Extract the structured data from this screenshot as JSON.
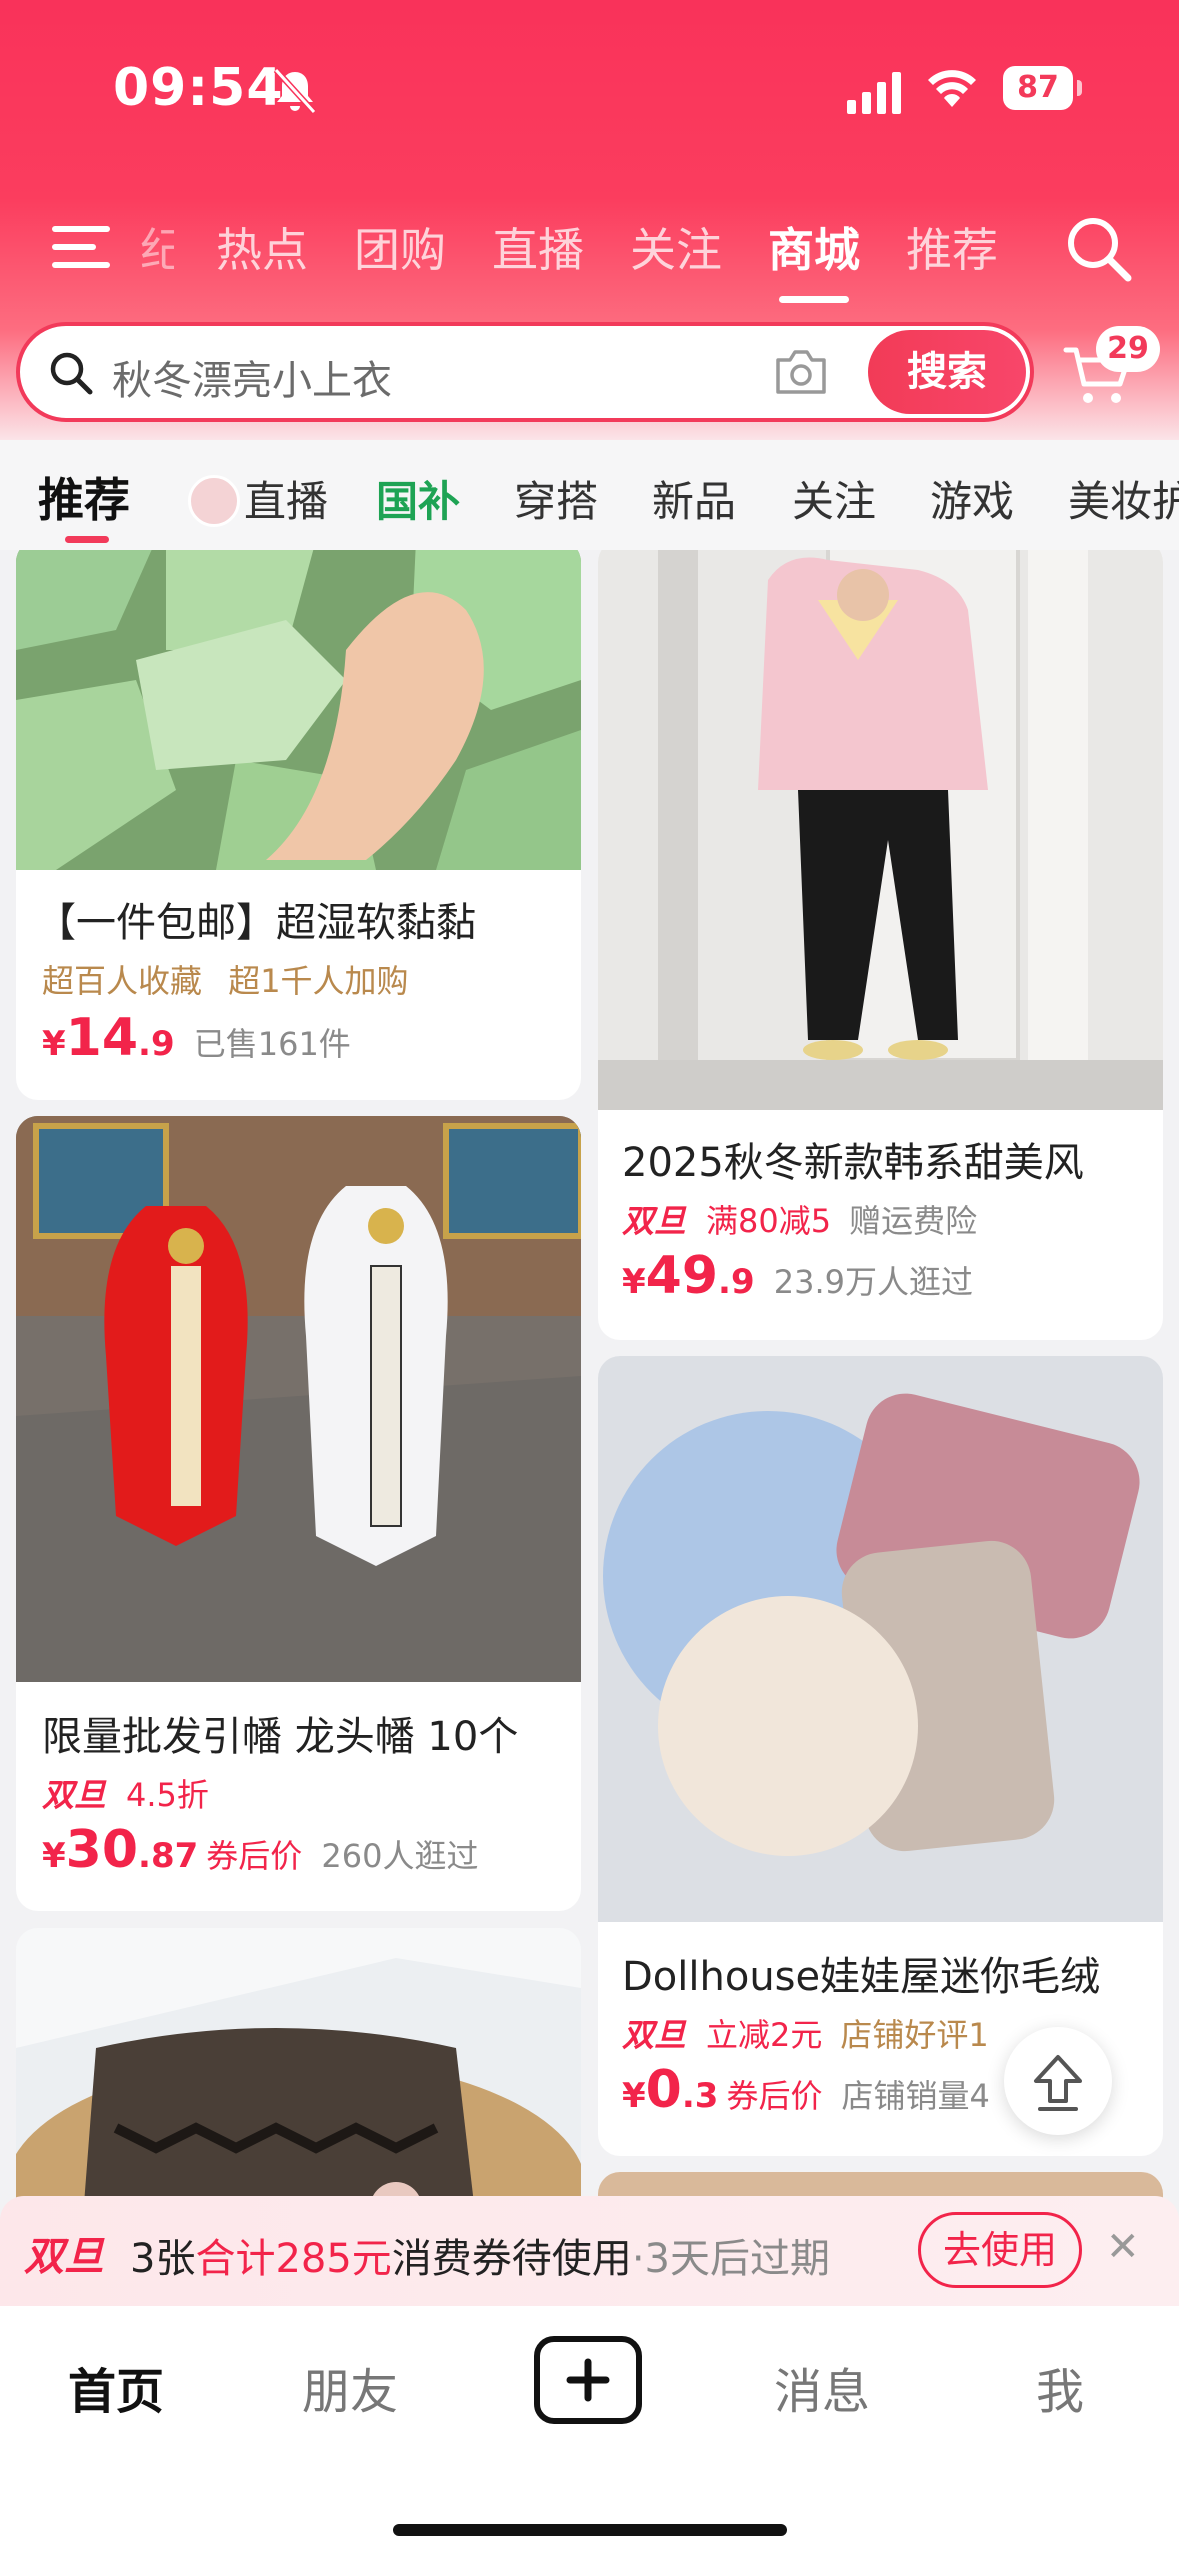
{
  "status": {
    "time": "09:54",
    "battery": "87"
  },
  "topnav": {
    "fragment": "纪",
    "tabs": [
      "热点",
      "团购",
      "直播",
      "关注",
      "商城",
      "推荐"
    ],
    "active": "商城"
  },
  "search": {
    "placeholder": "秋冬漂亮小上衣",
    "button": "搜索",
    "cart_badge": "29"
  },
  "categories": [
    "推荐",
    "直播",
    "国补",
    "穿搭",
    "新品",
    "关注",
    "游戏",
    "美妆护"
  ],
  "products": {
    "p1": {
      "title": "【一件包邮】超湿软黏黏",
      "tag1": "超百人收藏",
      "tag2": "超1千人加购",
      "currency": "¥",
      "int": "14",
      "dec": ".9",
      "sold": "已售161件"
    },
    "p2": {
      "title": "2025秋冬新款韩系甜美风",
      "badge": "双旦",
      "tag1": "满80减5",
      "tag2": "赠运费险",
      "currency": "¥",
      "int": "49",
      "dec": ".9",
      "sold": "23.9万人逛过"
    },
    "p3": {
      "title": "限量批发引幡 龙头幡 10个",
      "badge": "双旦",
      "tag1": "4.5折",
      "currency": "¥",
      "int": "30",
      "dec": ".87",
      "after": "券后价",
      "sold": "260人逛过"
    },
    "p4": {
      "title": "Dollhouse娃娃屋迷你毛绒",
      "badge": "双旦",
      "tag1": "立减2元",
      "tag2": "店铺好评1",
      "currency": "¥",
      "int": "0",
      "dec": ".3",
      "after": "券后价",
      "sold": "店铺销量4"
    }
  },
  "coupon": {
    "logo": "双旦",
    "count": "3张",
    "total": "合计285元",
    "desc": "消费券待使用",
    "expire": "·3天后过期",
    "button": "去使用"
  },
  "tabbar": {
    "home": "首页",
    "friends": "朋友",
    "messages": "消息",
    "me": "我"
  },
  "colors": {
    "brand": "#f23a5a",
    "price": "#f2244a",
    "green": "#1ea354"
  }
}
